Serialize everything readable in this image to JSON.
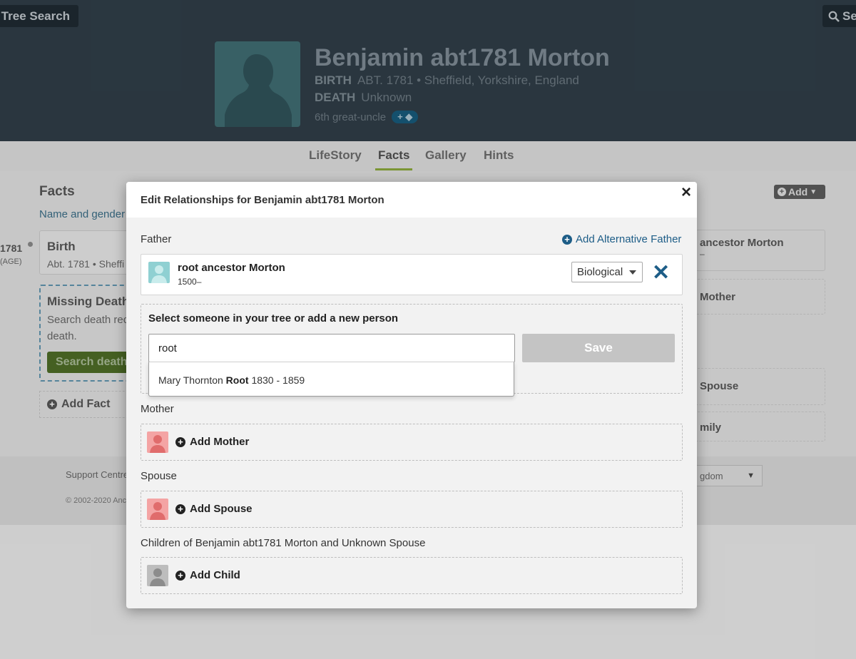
{
  "header": {
    "tree_search_label": "Tree Search",
    "search_label": "Se"
  },
  "person": {
    "name": "Benjamin abt1781 Morton",
    "birth_label": "BIRTH",
    "birth_value": "ABT. 1781 • Sheffield, Yorkshire, England",
    "death_label": "DEATH",
    "death_value": "Unknown",
    "relationship": "6th great-uncle",
    "tag_label": "+"
  },
  "tabs": [
    {
      "label": "LifeStory"
    },
    {
      "label": "Facts"
    },
    {
      "label": "Gallery"
    },
    {
      "label": "Hints"
    }
  ],
  "facts_panel": {
    "heading": "Facts",
    "name_gender_link": "Name and gender",
    "timeline_year": "1781",
    "timeline_age": "(AGE)",
    "birth_title": "Birth",
    "birth_detail": "Abt. 1781 • Sheffi",
    "missing_title": "Missing Death",
    "missing_text": "Search death rec death.",
    "search_button": "Search death",
    "add_fact": "Add Fact"
  },
  "right_panel": {
    "add_label": "Add",
    "father_card": "ancestor Morton",
    "father_card_sub": "–",
    "mother_card": "Mother",
    "spouse_card": "Spouse",
    "family_card": "mily"
  },
  "footer": {
    "support": "Support Centre",
    "copyright": "© 2002-2020 Anc",
    "language": "gdom"
  },
  "modal": {
    "title": "Edit Relationships for Benjamin abt1781 Morton",
    "close_glyph": "×",
    "father_label": "Father",
    "add_alt_father": "Add Alternative Father",
    "father": {
      "name": "root ancestor Morton",
      "dates": "1500–",
      "relationship_type": "Biological"
    },
    "remove_glyph": "✕",
    "select_title": "Select someone in your tree or add a new person",
    "search": {
      "value": "root",
      "save_label": "Save"
    },
    "suggestion": {
      "before": "Mary Thornton",
      "match": "Root",
      "dates": "1830 - 1859"
    },
    "mother_label": "Mother",
    "add_mother": "Add Mother",
    "spouse_label": "Spouse",
    "add_spouse": "Add Spouse",
    "children_label": "Children of Benjamin abt1781 Morton and Unknown Spouse",
    "add_child": "Add Child"
  },
  "colors": {
    "accent_blue": "#1d5d87",
    "male_avatar": "#8fd0d2",
    "female_avatar": "#f4a4a4",
    "unknown_avatar": "#bdbdbd",
    "save_disabled": "#c4c4c4"
  }
}
